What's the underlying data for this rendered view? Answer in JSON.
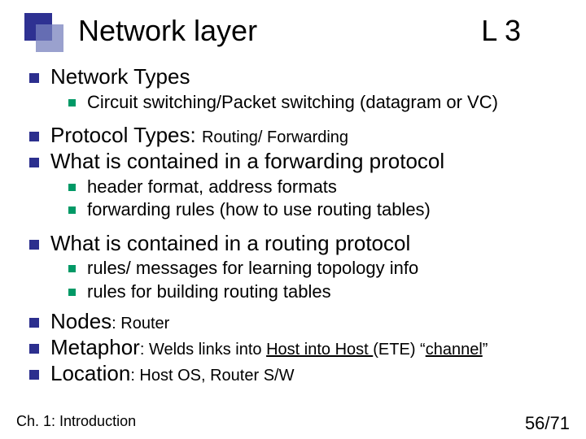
{
  "title": {
    "left": "Network layer",
    "right": "L 3"
  },
  "items": {
    "networkTypes": "Network Types",
    "circuit": "Circuit switching/Packet switching (datagram or VC)",
    "protocolTypes": {
      "a": "Protocol Types: ",
      "b": "Routing/ Forwarding"
    },
    "forwarding": "What is contained in a forwarding protocol",
    "fp1": "header format, address formats",
    "fp2": "forwarding rules (how to use routing tables)",
    "routing": "What is contained in a routing protocol",
    "rp1": "rules/ messages for learning topology info",
    "rp2": "rules for building routing tables",
    "nodes": {
      "a": "Nodes",
      "b": ": Router"
    },
    "metaphor": {
      "a": "Metaphor",
      "b": ": Welds links into ",
      "c": "Host into Host ",
      "d": "(ETE) “",
      "e": "channel",
      "f": "”"
    },
    "location": {
      "a": "Location",
      "b": ": Host OS, Router S/W"
    }
  },
  "footer": {
    "left": "Ch. 1: Introduction",
    "right": "56/71"
  }
}
